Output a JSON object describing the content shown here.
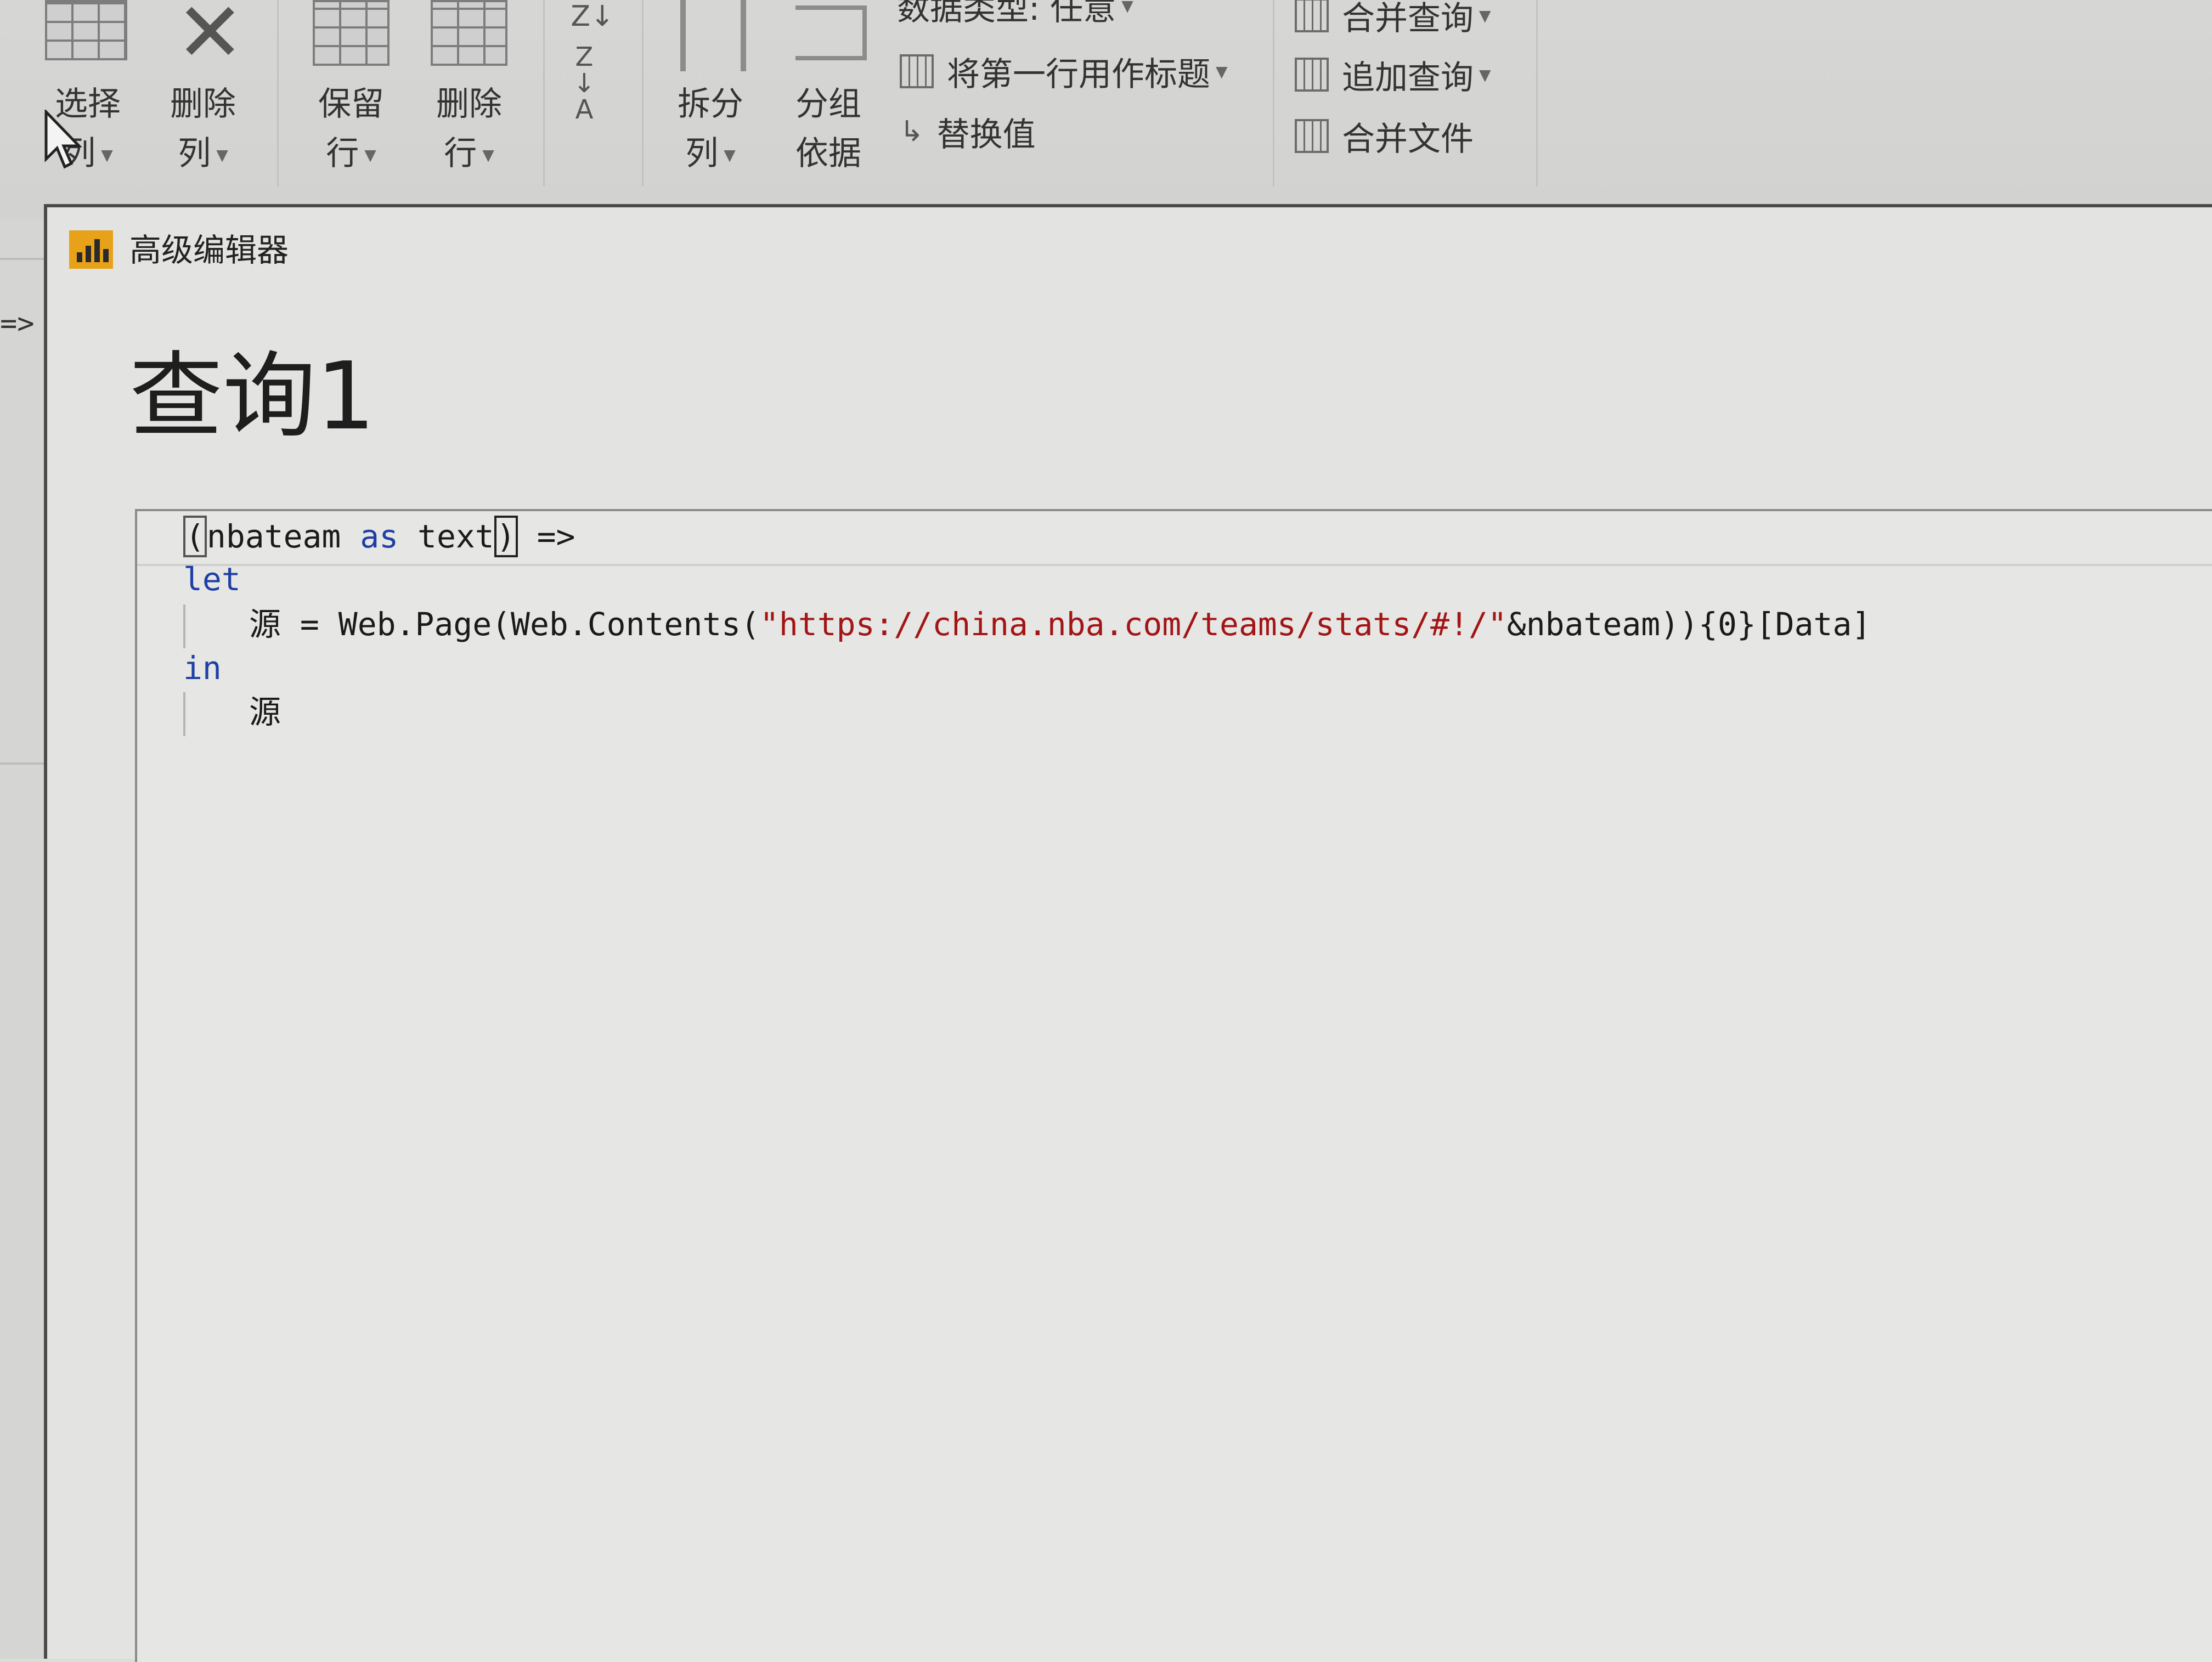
{
  "ribbon": {
    "select_columns": {
      "line1": "选择",
      "line2": "列"
    },
    "remove_columns": {
      "line1": "删除",
      "line2": "列"
    },
    "keep_rows": {
      "line1": "保留",
      "line2": "行"
    },
    "remove_rows": {
      "line1": "删除",
      "line2": "行"
    },
    "sort_asc": "Z↓",
    "sort_desc": "Z↓A",
    "split_column": {
      "line1": "拆分",
      "line2": "列"
    },
    "group_by": {
      "line1": "分组",
      "line2": "依据"
    },
    "data_type": "数据类型: 任意",
    "use_first_row_as_headers": "将第一行用作标题",
    "replace_values": "替换值",
    "merge_queries": "合并查询",
    "append_queries": "追加查询",
    "combine_files": "合并文件"
  },
  "left_edge_text": "=>",
  "dialog": {
    "title": "高级编辑器",
    "query_name": "查询1"
  },
  "editor": {
    "line1": {
      "open_paren": "(",
      "param": "nbateam",
      "kw_as": "as",
      "type": "text",
      "close_paren": ")",
      "arrow": " =>"
    },
    "line2": {
      "kw": "let"
    },
    "line3": {
      "name": "源",
      "eq": " = ",
      "call_start": "Web.Page(Web.Contents(",
      "url": "\"https://china.nba.com/teams/stats/#!/\"",
      "call_end": "&nbateam)){0}[Data]"
    },
    "line4": {
      "kw": "in"
    },
    "line5": {
      "name": "源"
    }
  },
  "colors": {
    "keyword": "#1f3fa6",
    "string": "#a31515",
    "app_icon": "#e8a21a"
  }
}
